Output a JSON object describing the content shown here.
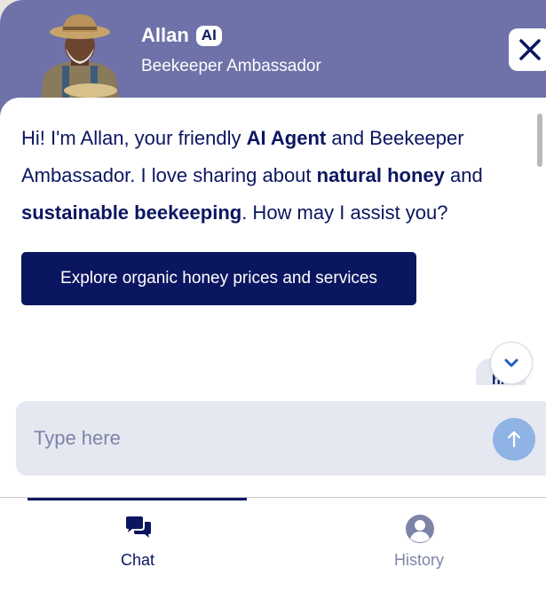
{
  "colors": {
    "header_bg": "#6e72a8",
    "brand_navy": "#0b1660",
    "input_bg": "#e6e8f1",
    "send_button": "#8fb3e5",
    "muted": "#7d84a8"
  },
  "header": {
    "agent_name": "Allan",
    "badge": "AI",
    "role": "Beekeeper Ambassador",
    "avatar_icon": "beekeeper-avatar",
    "close_icon": "close-icon"
  },
  "message": {
    "part1": "Hi! I'm Allan, your friendly ",
    "bold1": "AI Agent",
    "part2": " and Beekeeper Ambassador. I love sharing about ",
    "bold2": "natural honey",
    "part3": " and ",
    "bold3": "sustainable beekeeping",
    "part4": ". How may I assist you?"
  },
  "suggestion_button": "Explore organic honey prices and services",
  "user_bubble_peek": "hi",
  "scroll_down_icon": "chevron-down-icon",
  "composer": {
    "placeholder": "Type here",
    "value": "",
    "send_icon": "arrow-up-icon"
  },
  "tabs": [
    {
      "label": "Chat",
      "icon": "chat-bubbles-icon",
      "active": true
    },
    {
      "label": "History",
      "icon": "user-circle-icon",
      "active": false
    }
  ]
}
